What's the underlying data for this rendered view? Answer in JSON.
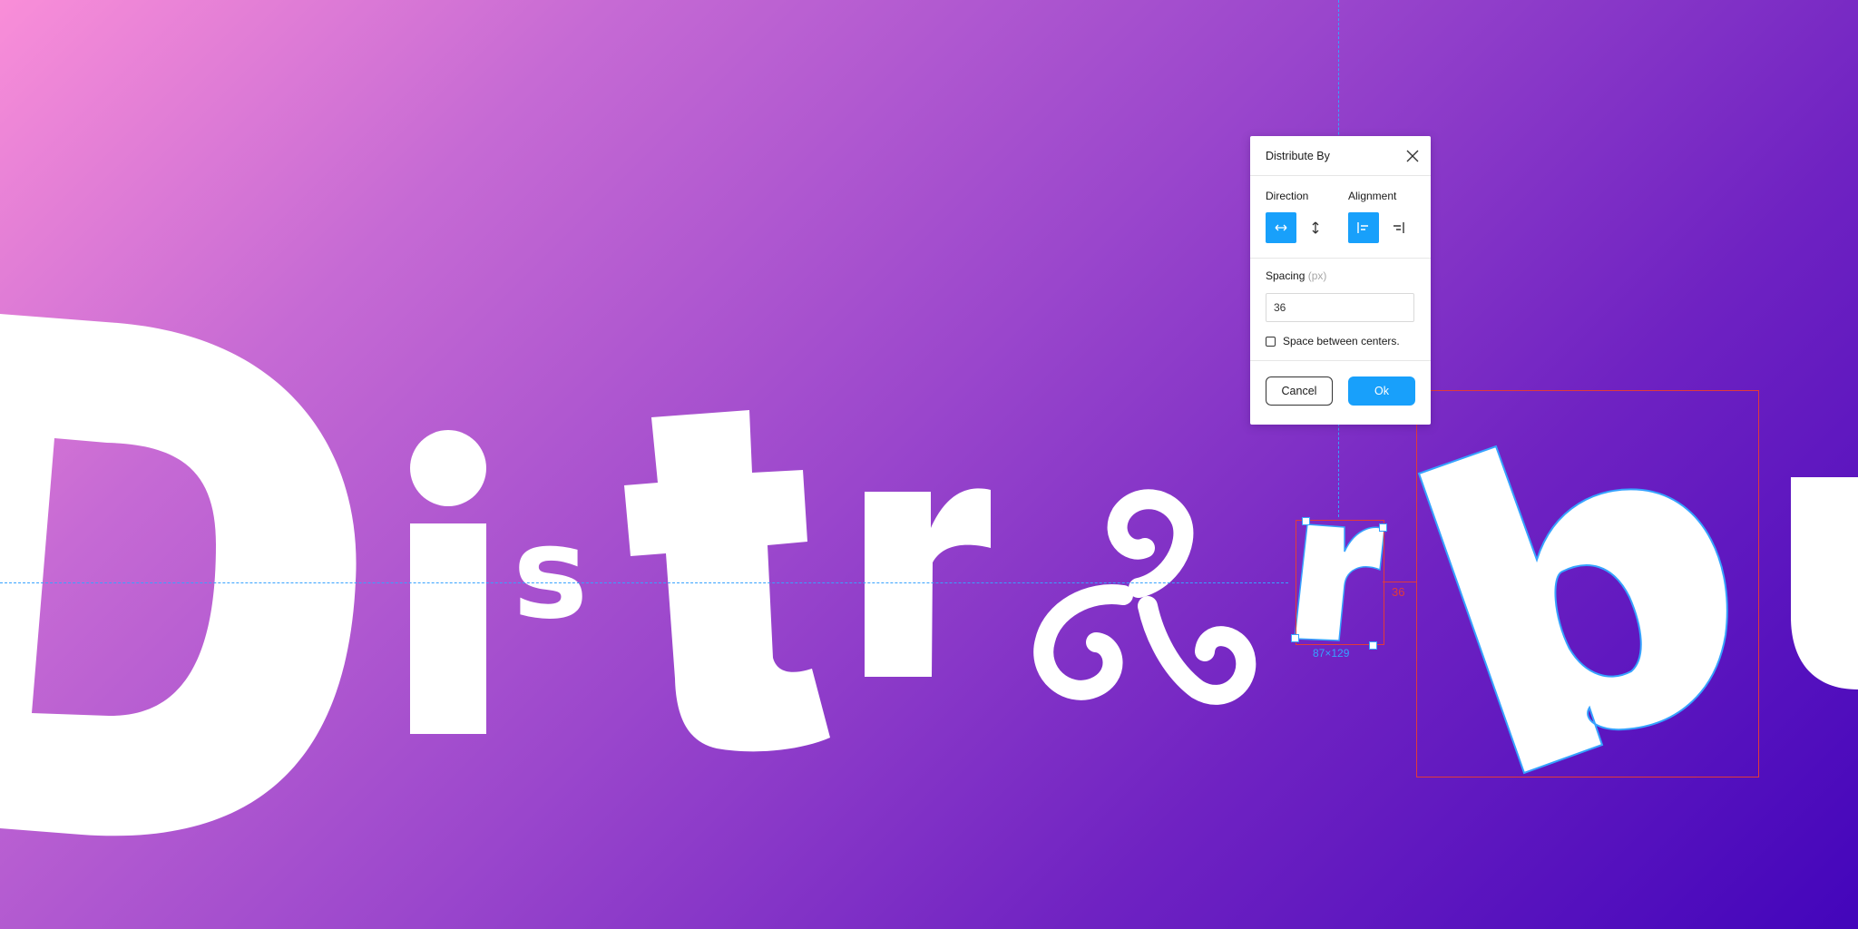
{
  "dialog": {
    "title": "Distribute By",
    "direction_label": "Direction",
    "alignment_label": "Alignment",
    "spacing_label": "Spacing",
    "spacing_unit": "(px)",
    "spacing_value": "36",
    "checkbox_label": "Space between centers.",
    "checkbox_checked": false,
    "cancel_label": "Cancel",
    "ok_label": "Ok"
  },
  "canvas": {
    "gap_label": "36",
    "dimension_label": "87×129"
  },
  "colors": {
    "accent": "#18a0fb",
    "selection": "#36a3ff",
    "measure": "#e23a3a",
    "gradient_start": "#f98ed8",
    "gradient_end": "#4305bb"
  },
  "icons": [
    "close-icon",
    "horizontal-arrows-icon",
    "vertical-arrows-icon",
    "align-left-icon",
    "align-right-icon"
  ]
}
